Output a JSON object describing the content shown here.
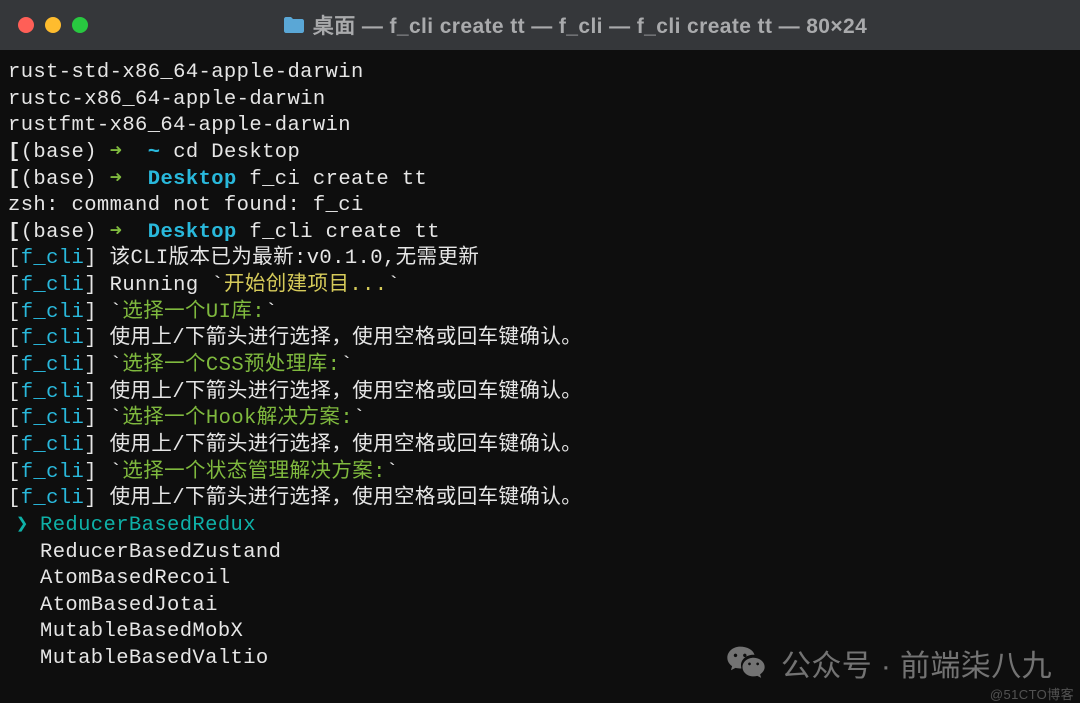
{
  "window": {
    "title": "桌面 — f_cli create tt — f_cli — f_cli create tt — 80×24"
  },
  "header_lines": {
    "l0": "rust-std-x86_64-apple-darwin",
    "l1": "rustc-x86_64-apple-darwin",
    "l2": "rustfmt-x86_64-apple-darwin"
  },
  "prompts": {
    "lbrace": "[",
    "rbrace": "]",
    "env": "(base)",
    "arrow": "➜",
    "tilde": "~",
    "desktop": "Desktop",
    "cd_cmd": "cd Desktop",
    "fci_cmd": "f_ci create tt",
    "fcli_cmd": "f_cli create tt",
    "zsh_err": "zsh: command not found: f_ci"
  },
  "cli": {
    "tag_open": "[",
    "tag_name": "f_cli",
    "tag_close": "]",
    "l_version": " 该CLI版本已为最新:v0.1.0,无需更新",
    "l_running_pre": " Running ",
    "l_running_tick": "`",
    "l_running_msg": "开始创建项目...",
    "q_ui": "选择一个UI库:",
    "q_css": "选择一个CSS预处理库:",
    "q_hook": "选择一个Hook解决方案:",
    "q_state": "选择一个状态管理解决方案:",
    "instruction": " 使用上/下箭头进行选择，使用空格或回车键确认。"
  },
  "options": {
    "selected_marker": "❯",
    "items": {
      "o0": "ReducerBasedRedux",
      "o1": "ReducerBasedZustand",
      "o2": "AtomBasedRecoil",
      "o3": "AtomBasedJotai",
      "o4": "MutableBasedMobX",
      "o5": "MutableBasedValtio"
    }
  },
  "watermark": {
    "text": "公众号 · 前端柒八九"
  },
  "attribution": "@51CTO博客"
}
